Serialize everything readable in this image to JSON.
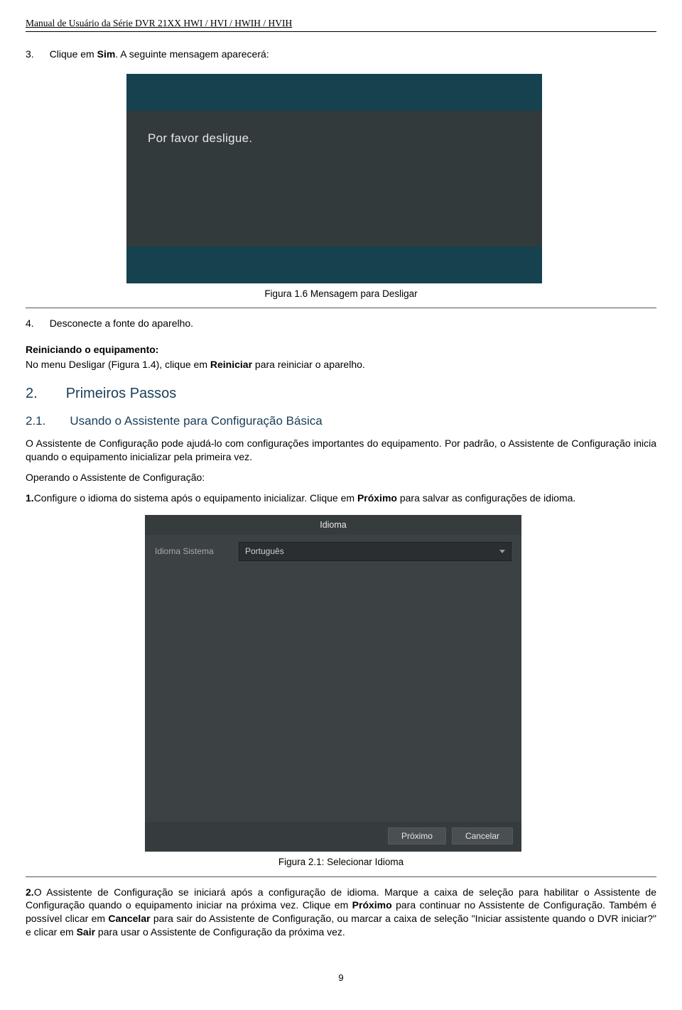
{
  "doc": {
    "header": "Manual de Usuário da Série DVR 21XX HWI / HVI / HWIH / HVIH",
    "page_number": "9"
  },
  "steps": {
    "s3_num": "3.",
    "s3_text_a": "Clique em ",
    "s3_text_b": "Sim",
    "s3_text_c": ". A seguinte mensagem aparecerá:",
    "shutdown_msg": "Por favor desligue.",
    "fig16_caption": "Figura 1.6 Mensagem para Desligar",
    "s4_num": "4.",
    "s4_text": "Desconecte a fonte do aparelho."
  },
  "restart": {
    "heading": "Reiniciando o equipamento:",
    "line_a": "No menu Desligar (Figura 1.4), clique em ",
    "line_b": "Reiniciar",
    "line_c": " para reiniciar o aparelho."
  },
  "sec2": {
    "num": "2.",
    "title": "Primeiros Passos",
    "sub_num": "2.1.",
    "sub_title": "Usando o Assistente para Configuração Básica",
    "p1": "O Assistente de Configuração pode ajudá-lo com configurações importantes do equipamento. Por padrão, o Assistente de Configuração inicia quando o equipamento inicializar pela primeira vez.",
    "op_heading": "Operando o Assistente de Configuração:",
    "op1_num": "1.",
    "op1_a": "Configure o idioma do sistema após o equipamento inicializar. Clique em ",
    "op1_b": "Próximo",
    "op1_c": " para salvar as configurações de idioma."
  },
  "idioma_dialog": {
    "title": "Idioma",
    "label": "Idioma Sistema",
    "value": "Português",
    "btn_next": "Próximo",
    "btn_cancel": "Cancelar"
  },
  "fig21_caption": "Figura 2.1: Selecionar Idioma",
  "sec2b": {
    "op2_num": "2.",
    "op2_a": "O Assistente de Configuração se iniciará após a configuração de idioma. Marque a caixa de seleção para habilitar o Assistente de Configuração quando o equipamento iniciar na próxima vez. Clique em ",
    "op2_b": "Próximo",
    "op2_c": " para continuar no Assistente de Configuração. Também é possível clicar em ",
    "op2_d": "Cancelar",
    "op2_e": " para sair do Assistente de Configuração, ou marcar a caixa de seleção \"Iniciar assistente quando o DVR iniciar?\" e clicar em ",
    "op2_f": "Sair",
    "op2_g": " para usar o Assistente de Configuração da próxima vez."
  }
}
